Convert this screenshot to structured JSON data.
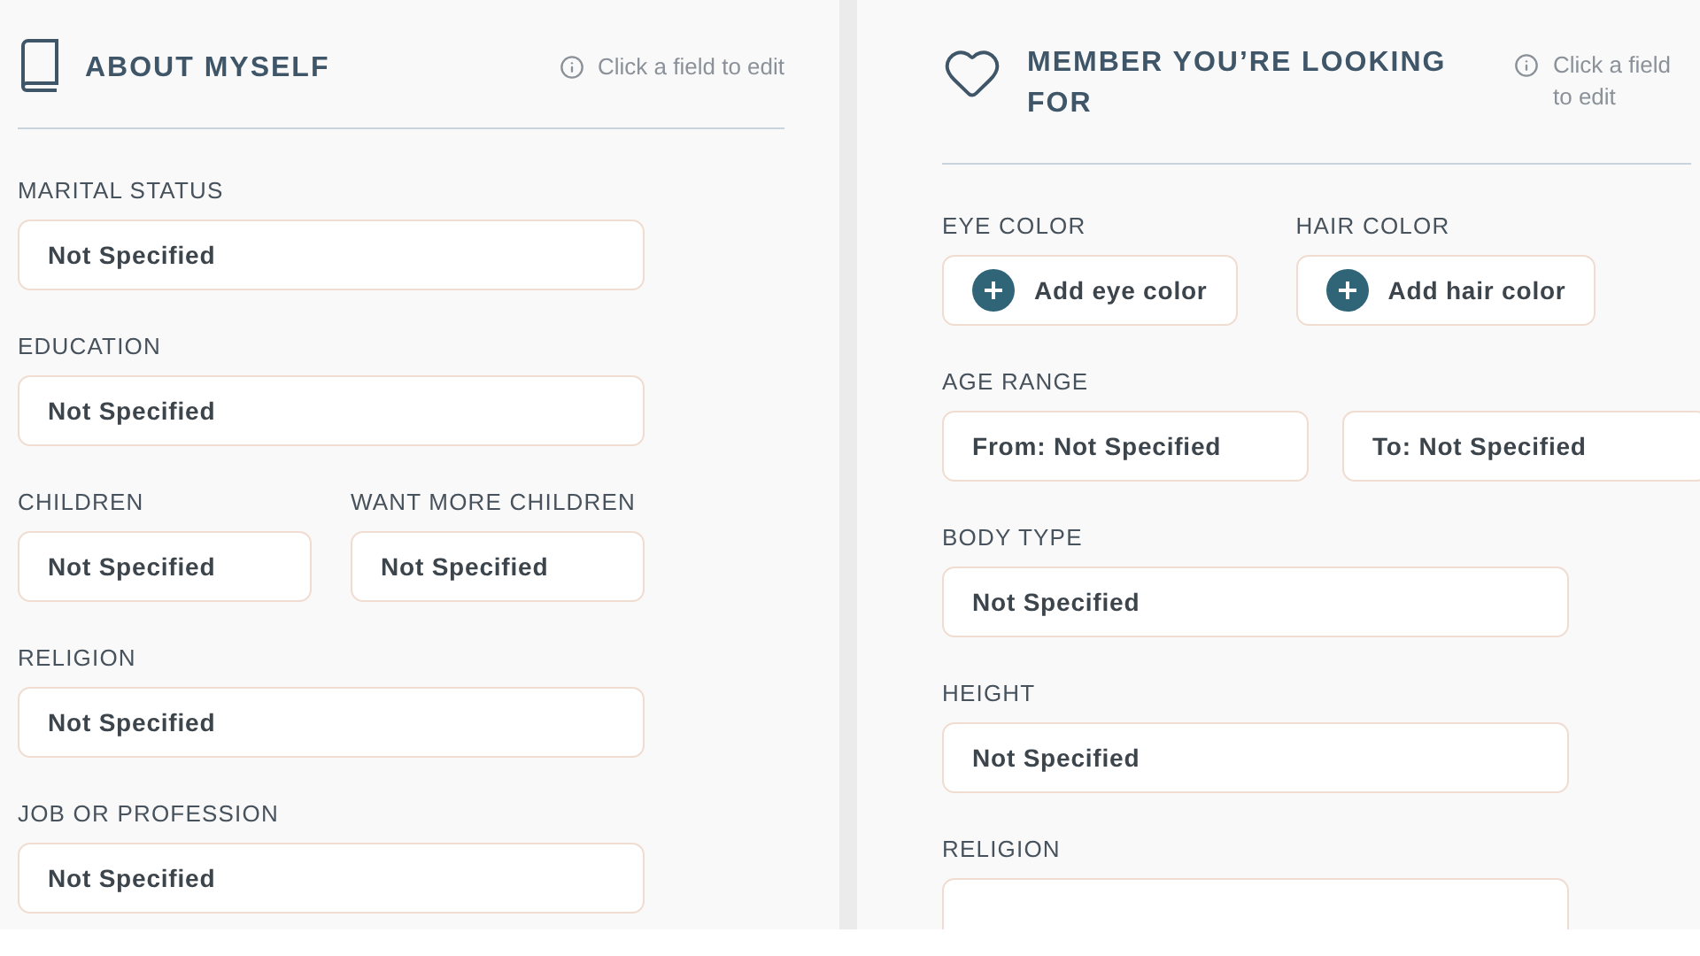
{
  "sections": [
    {
      "title": "ABOUT MYSELF",
      "hint": "Click a field to edit",
      "rows": [
        {
          "groups": [
            {
              "label": "MARITAL STATUS",
              "fields": [
                {
                  "kind": "value",
                  "text": "Not Specified"
                }
              ]
            }
          ]
        },
        {
          "groups": [
            {
              "label": "EDUCATION",
              "fields": [
                {
                  "kind": "value",
                  "text": "Not Specified"
                }
              ]
            }
          ]
        },
        {
          "groups": [
            {
              "label": "CHILDREN",
              "fields": [
                {
                  "kind": "value",
                  "text": "Not Specified"
                }
              ]
            },
            {
              "label": "WANT MORE CHILDREN",
              "fields": [
                {
                  "kind": "value",
                  "text": "Not Specified"
                }
              ]
            }
          ]
        },
        {
          "groups": [
            {
              "label": "RELIGION",
              "fields": [
                {
                  "kind": "value",
                  "text": "Not Specified"
                }
              ]
            }
          ]
        },
        {
          "groups": [
            {
              "label": "JOB OR PROFESSION",
              "fields": [
                {
                  "kind": "value",
                  "text": "Not Specified"
                }
              ]
            }
          ]
        }
      ]
    },
    {
      "title": "MEMBER YOU’RE LOOKING FOR",
      "hint": "Click a field to edit",
      "rows": [
        {
          "groups": [
            {
              "label": "EYE COLOR",
              "fields": [
                {
                  "kind": "add",
                  "text": "Add eye color"
                }
              ]
            },
            {
              "label": "HAIR COLOR",
              "fields": [
                {
                  "kind": "add",
                  "text": "Add hair color"
                }
              ]
            }
          ]
        },
        {
          "groups": [
            {
              "label": "AGE RANGE",
              "fields": [
                {
                  "kind": "value",
                  "text": "From: Not Specified"
                },
                {
                  "kind": "value",
                  "text": "To: Not Specified"
                }
              ]
            }
          ]
        },
        {
          "groups": [
            {
              "label": "BODY TYPE",
              "fields": [
                {
                  "kind": "value",
                  "text": "Not Specified"
                }
              ]
            }
          ]
        },
        {
          "groups": [
            {
              "label": "HEIGHT",
              "fields": [
                {
                  "kind": "value",
                  "text": "Not Specified"
                }
              ]
            }
          ]
        },
        {
          "groups": [
            {
              "label": "RELIGION",
              "fields": [
                {
                  "kind": "value"
                }
              ]
            }
          ]
        }
      ]
    }
  ]
}
